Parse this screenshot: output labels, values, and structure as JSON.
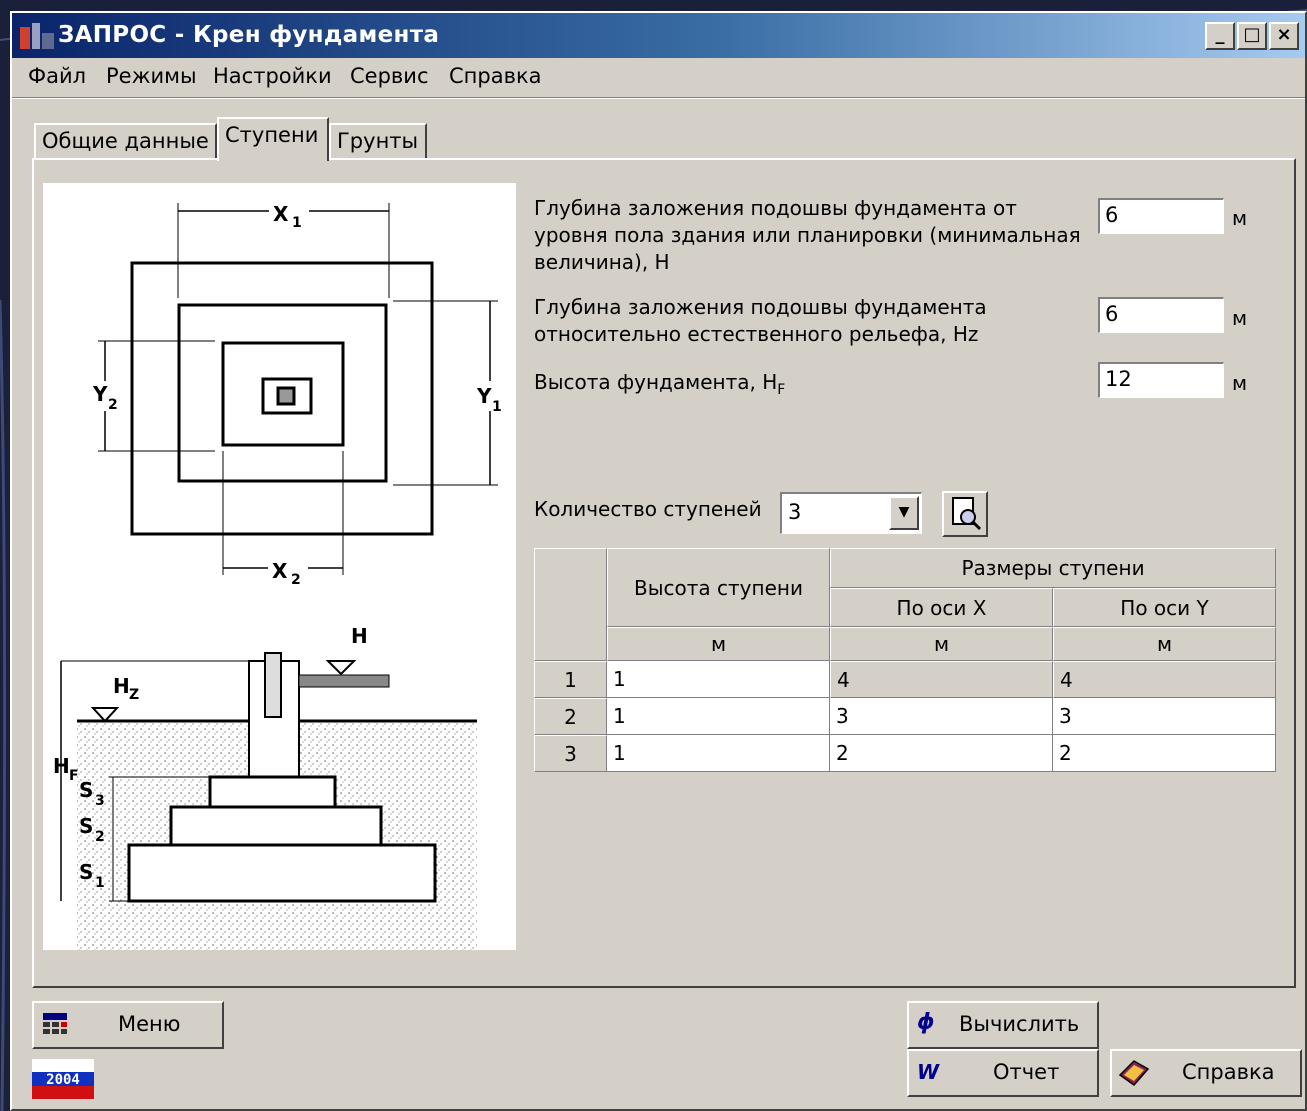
{
  "window": {
    "title": "ЗАПРОС - Крен фундамента",
    "controls": [
      "_",
      "□",
      "×"
    ]
  },
  "menu": [
    "Файл",
    "Режимы",
    "Настройки",
    "Сервис",
    "Справка"
  ],
  "tabs": [
    "Общие данные",
    "Ступени",
    "Грунты"
  ],
  "active_tab": "Ступени",
  "drawing": {
    "plan_labels": {
      "x1": "X",
      "x1_sub": "1",
      "x2": "X",
      "x2_sub": "2",
      "y1": "Y",
      "y1_sub": "1",
      "y2": "Y",
      "y2_sub": "2"
    },
    "section_labels": {
      "h": "H",
      "hz": "H",
      "hz_sub": "Z",
      "hf": "H",
      "hf_sub": "F",
      "s1": "S",
      "s1_sub": "1",
      "s2": "S",
      "s2_sub": "2",
      "s3": "S",
      "s3_sub": "3"
    }
  },
  "fields": [
    {
      "label": "Глубина заложения подошвы фундамента от уровня пола здания или планировки (минимальная величина), H",
      "value": "6",
      "unit": "м"
    },
    {
      "label": "Глубина заложения подошвы фундамента относительно естественного рельефа, Hz",
      "value": "6",
      "unit": "м"
    },
    {
      "label": "Высота фундамента, H",
      "label_sub": "F",
      "value": "12",
      "unit": "м"
    }
  ],
  "steps_count": {
    "label": "Количество ступеней",
    "value": "3"
  },
  "table": {
    "col_height": "Высота ступени",
    "col_sizes": "Размеры ступени",
    "col_x": "По оси X",
    "col_y": "По оси Y",
    "units": [
      "м",
      "м",
      "м"
    ],
    "rows": [
      {
        "n": "1",
        "h": "1",
        "x": "4",
        "y": "4"
      },
      {
        "n": "2",
        "h": "1",
        "x": "3",
        "y": "3"
      },
      {
        "n": "3",
        "h": "1",
        "x": "2",
        "y": "2"
      }
    ]
  },
  "buttons": {
    "menu": "Меню",
    "compute": "Вычислить",
    "report": "Отчет",
    "help": "Справка"
  },
  "badge": "2004"
}
